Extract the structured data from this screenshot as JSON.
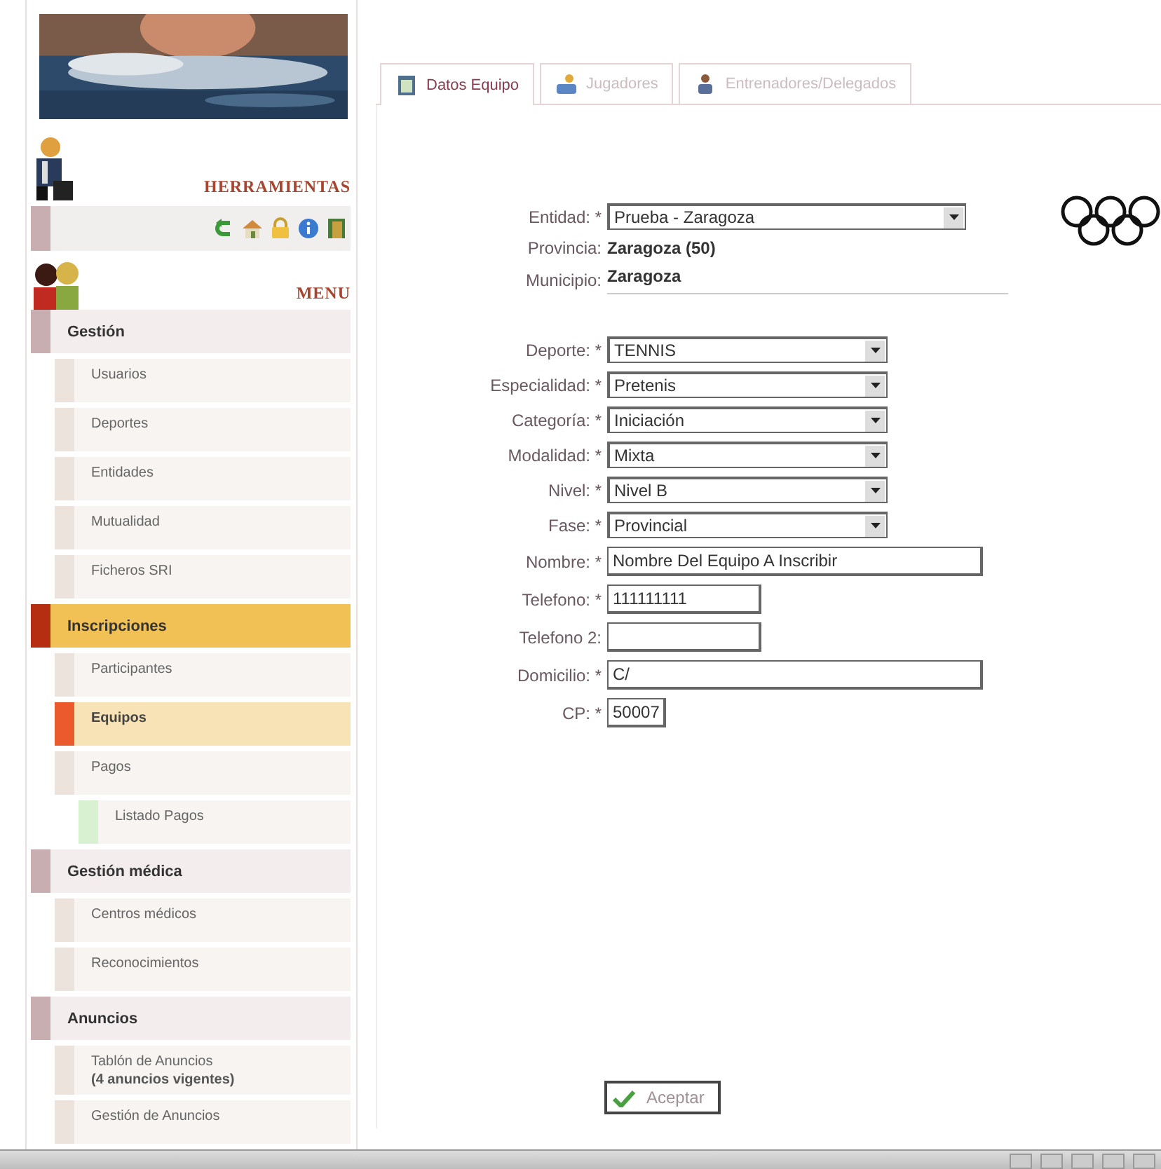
{
  "sidebar": {
    "tools_title": "HERRAMIENTAS",
    "menu_title": "MENU",
    "menu": [
      {
        "label": "Gestión",
        "selected": false,
        "children": [
          {
            "label": "Usuarios",
            "selected": false
          },
          {
            "label": "Deportes",
            "selected": false
          },
          {
            "label": "Entidades",
            "selected": false
          },
          {
            "label": "Mutualidad",
            "selected": false
          },
          {
            "label": "Ficheros SRI",
            "selected": false
          }
        ]
      },
      {
        "label": "Inscripciones",
        "selected": true,
        "children": [
          {
            "label": "Participantes",
            "selected": false
          },
          {
            "label": "Equipos",
            "selected": true
          },
          {
            "label": "Pagos",
            "selected": false,
            "children": [
              {
                "label": "Listado Pagos",
                "selected": false
              }
            ]
          }
        ]
      },
      {
        "label": "Gestión médica",
        "selected": false,
        "children": [
          {
            "label": "Centros médicos",
            "selected": false
          },
          {
            "label": "Reconocimientos",
            "selected": false
          }
        ]
      },
      {
        "label": "Anuncios",
        "selected": false,
        "children": [
          {
            "label": "Tablón de Anuncios",
            "note": "(4 anuncios vigentes)",
            "selected": false
          },
          {
            "label": "Gestión de Anuncios",
            "selected": false
          }
        ]
      }
    ]
  },
  "tabs": [
    {
      "label": "Datos Equipo",
      "selected": true
    },
    {
      "label": "Jugadores",
      "selected": false
    },
    {
      "label": "Entrenadores/Delegados",
      "selected": false
    }
  ],
  "form": [
    {
      "kind": "select",
      "label": "Entidad: *",
      "value": "Prueba - Zaragoza"
    },
    {
      "kind": "static",
      "label": "Provincia:",
      "value": "Zaragoza (50)"
    },
    {
      "kind": "static",
      "label": "Municipio:",
      "value": "Zaragoza"
    },
    {
      "kind": "select",
      "label": "Deporte: *",
      "value": "TENNIS"
    },
    {
      "kind": "select",
      "label": "Especialidad: *",
      "value": "Pretenis"
    },
    {
      "kind": "select",
      "label": "Categoría: *",
      "value": "Iniciación"
    },
    {
      "kind": "select",
      "label": "Modalidad: *",
      "value": "Mixta"
    },
    {
      "kind": "select",
      "label": "Nivel: *",
      "value": "Nivel B"
    },
    {
      "kind": "select",
      "label": "Fase: *",
      "value": "Provincial"
    },
    {
      "kind": "input",
      "label": "Nombre: *",
      "value": "Nombre Del Equipo A Inscribir"
    },
    {
      "kind": "input",
      "label": "Telefono: *",
      "value": "111111111"
    },
    {
      "kind": "input",
      "label": "Telefono 2:"
    },
    {
      "kind": "input",
      "label": "Domicilio: *",
      "value": "C/"
    },
    {
      "kind": "input",
      "label": "CP: *",
      "value": "50007"
    }
  ],
  "submit": "Aceptar"
}
